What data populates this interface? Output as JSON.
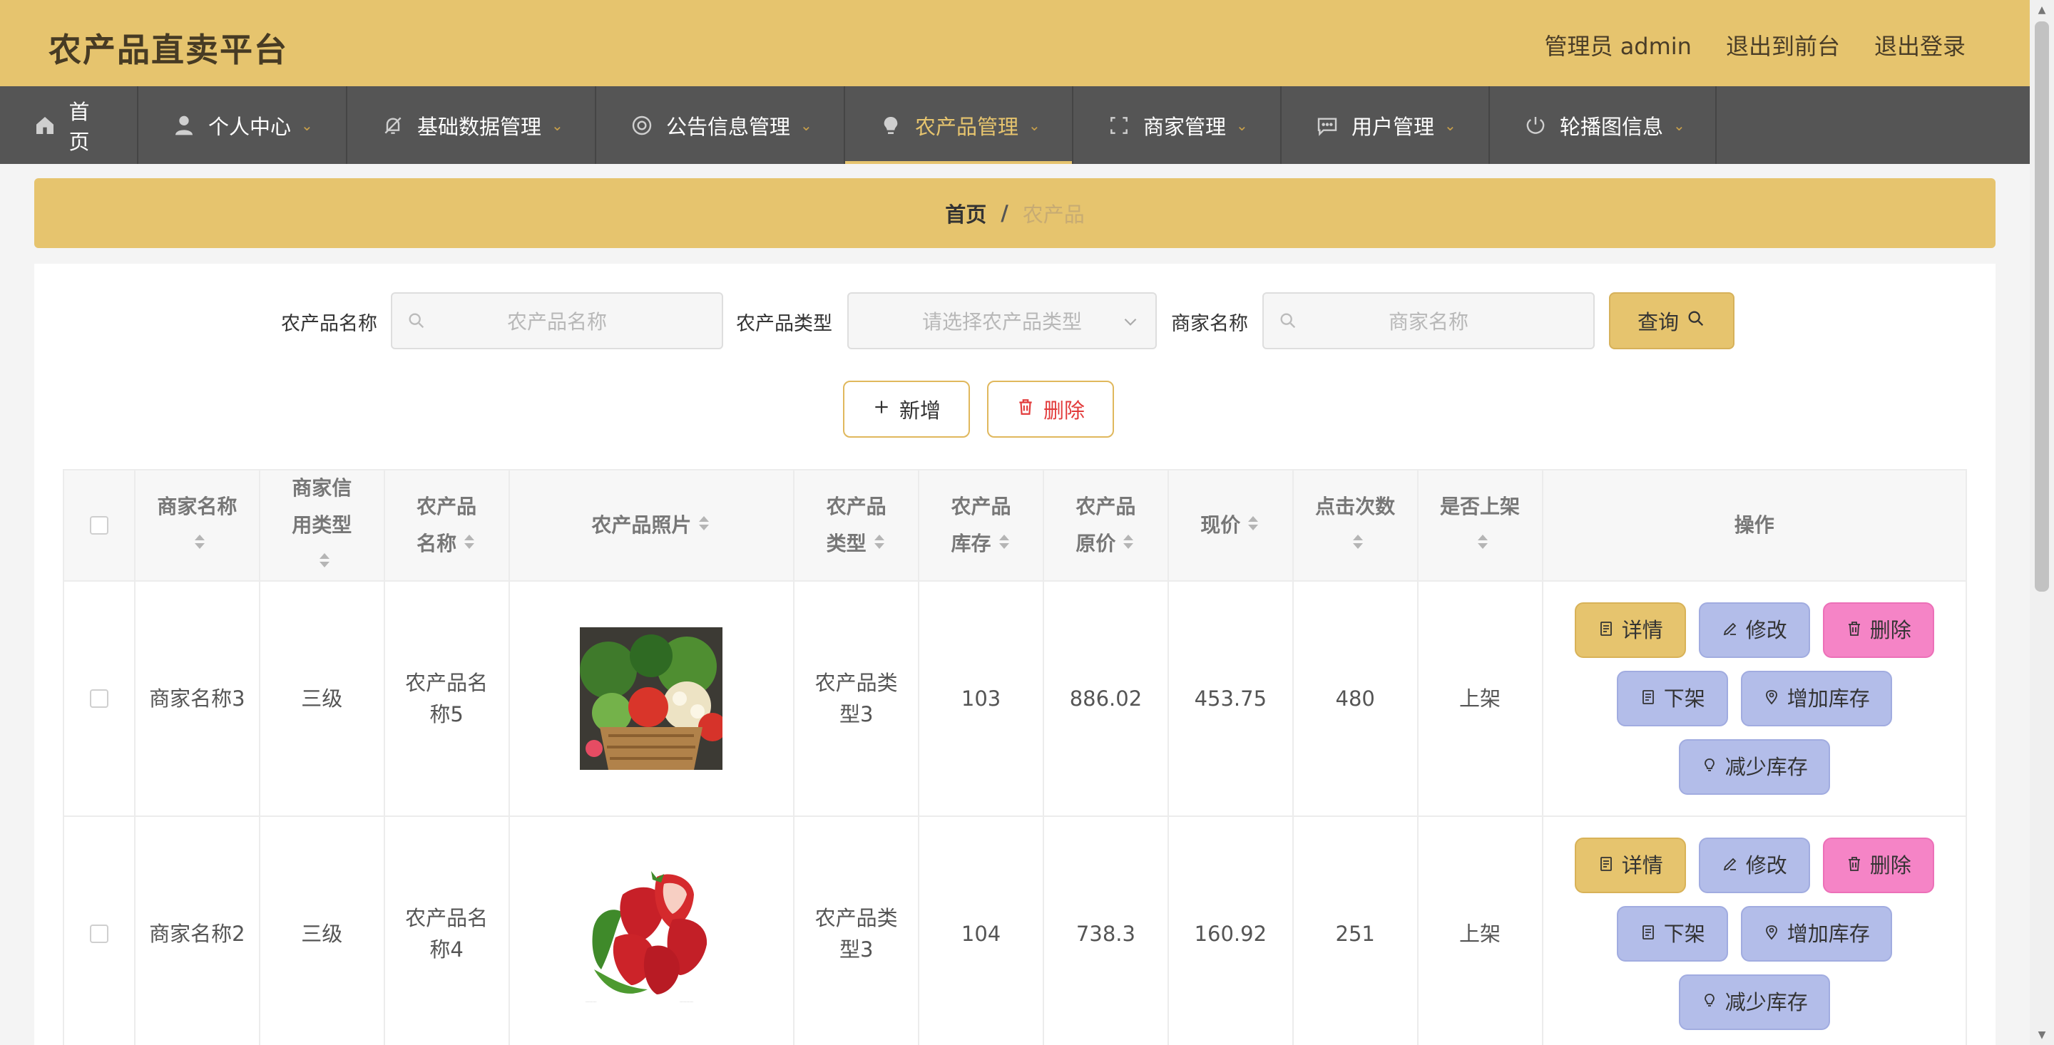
{
  "app_title": "农产品直卖平台",
  "header_links": {
    "user": "管理员 admin",
    "to_front": "退出到前台",
    "logout": "退出登录"
  },
  "nav": {
    "items": [
      {
        "label": "首页",
        "icon": "home-icon"
      },
      {
        "label": "个人中心",
        "icon": "user-icon"
      },
      {
        "label": "基础数据管理",
        "icon": "bell-off-icon"
      },
      {
        "label": "公告信息管理",
        "icon": "lifebuoy-icon"
      },
      {
        "label": "农产品管理",
        "icon": "lightbulb-icon"
      },
      {
        "label": "商家管理",
        "icon": "frame-icon"
      },
      {
        "label": "用户管理",
        "icon": "chat-icon"
      },
      {
        "label": "轮播图信息",
        "icon": "power-icon"
      }
    ],
    "active_index": 4
  },
  "breadcrumb": {
    "home": "首页",
    "separator": "/",
    "current": "农产品"
  },
  "search": {
    "name_label": "农产品名称",
    "name_placeholder": "农产品名称",
    "type_label": "农产品类型",
    "type_placeholder": "请选择农产品类型",
    "merchant_label": "商家名称",
    "merchant_placeholder": "商家名称",
    "query_label": "查询"
  },
  "actions": {
    "add_label": "新增",
    "delete_label": "删除"
  },
  "table": {
    "headers": {
      "merchant_name": "商家名称",
      "credit_type": "商家信用类型",
      "product_name": "农产品名称",
      "photo": "农产品照片",
      "product_type": "农产品类型",
      "stock": "农产品库存",
      "original_price": "农产品原价",
      "current_price": "现价",
      "clicks": "点击次数",
      "on_shelf": "是否上架",
      "ops": "操作"
    },
    "rows": [
      {
        "merchant_name": "商家名称3",
        "credit_type": "三级",
        "product_name": "农产品名称5",
        "photo": "vegetable-basket-photo",
        "product_type": "农产品类型3",
        "stock": "103",
        "original_price": "886.02",
        "current_price": "453.75",
        "clicks": "480",
        "on_shelf": "上架"
      },
      {
        "merchant_name": "商家名称2",
        "credit_type": "三级",
        "product_name": "农产品名称4",
        "photo": "strawberries-photo",
        "product_type": "农产品类型3",
        "stock": "104",
        "original_price": "738.3",
        "current_price": "160.92",
        "clicks": "251",
        "on_shelf": "上架"
      }
    ],
    "row_ops": {
      "detail": "详情",
      "edit": "修改",
      "delete": "删除",
      "off_shelf": "下架",
      "add_stock": "增加库存",
      "reduce_stock": "减少库存"
    }
  },
  "colors": {
    "header_bg": "#e6c46e",
    "nav_bg": "#555555",
    "accent": "#e6c46e",
    "edit_btn": "#b3bde9",
    "delete_btn": "#f584c6",
    "danger_text": "#e23b3b"
  }
}
